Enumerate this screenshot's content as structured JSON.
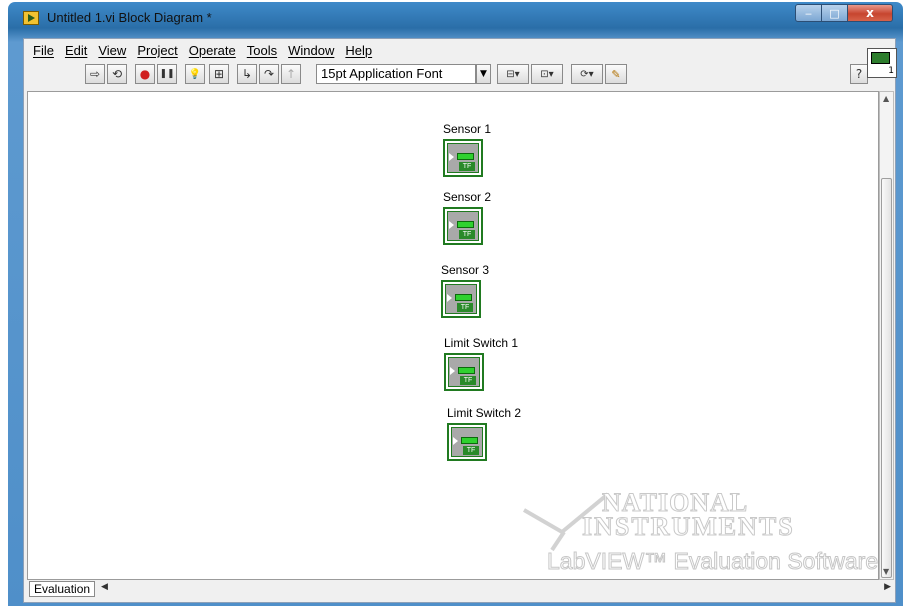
{
  "window": {
    "title": "Untitled 1.vi Block Diagram *",
    "minimize_glyph": "‒",
    "maximize_glyph": "□",
    "close_glyph": "x"
  },
  "menu": [
    "File",
    "Edit",
    "View",
    "Project",
    "Operate",
    "Tools",
    "Window",
    "Help"
  ],
  "toolbar": {
    "font_selector_value": "15pt Application Font",
    "help_button_glyph": "?",
    "vi_icon_number": "1",
    "buttons": [
      {
        "name": "run-icon",
        "glyph": "⇨"
      },
      {
        "name": "run-continuously-icon",
        "glyph": "⟲"
      },
      {
        "name": "abort-icon",
        "glyph": "●"
      },
      {
        "name": "pause-icon",
        "glyph": "❚❚"
      },
      {
        "name": "highlight-execution-icon",
        "glyph": "💡"
      },
      {
        "name": "retain-wire-values-icon",
        "glyph": "⊞"
      },
      {
        "name": "step-into-icon",
        "glyph": "↳"
      },
      {
        "name": "step-over-icon",
        "glyph": "↷"
      },
      {
        "name": "step-out-icon",
        "glyph": "↑"
      },
      {
        "name": "align-objects-icon",
        "glyph": "⊟▾"
      },
      {
        "name": "distribute-objects-icon",
        "glyph": "⊡▾"
      },
      {
        "name": "reorder-icon",
        "glyph": "⟳▾"
      },
      {
        "name": "clean-up-diagram-icon",
        "glyph": "✎"
      }
    ]
  },
  "terminals": [
    {
      "label": "Sensor 1",
      "type_code": "TF"
    },
    {
      "label": "Sensor 2",
      "type_code": "TF"
    },
    {
      "label": "Sensor  3",
      "type_code": "TF"
    },
    {
      "label": "Limit Switch 1",
      "type_code": "TF"
    },
    {
      "label": "Limit Switch 2",
      "type_code": "TF"
    }
  ],
  "status_bar": {
    "tab_label": "Evaluation"
  },
  "watermark": {
    "line1": "NATIONAL",
    "line2": "INSTRUMENTS",
    "line3": "LabVIEW™ Evaluation Software"
  },
  "colors": {
    "title_bar": "#3f8ac9",
    "boolean_terminal_border": "#207a20",
    "boolean_led": "#2fd12f",
    "close_button": "#c7452f"
  }
}
